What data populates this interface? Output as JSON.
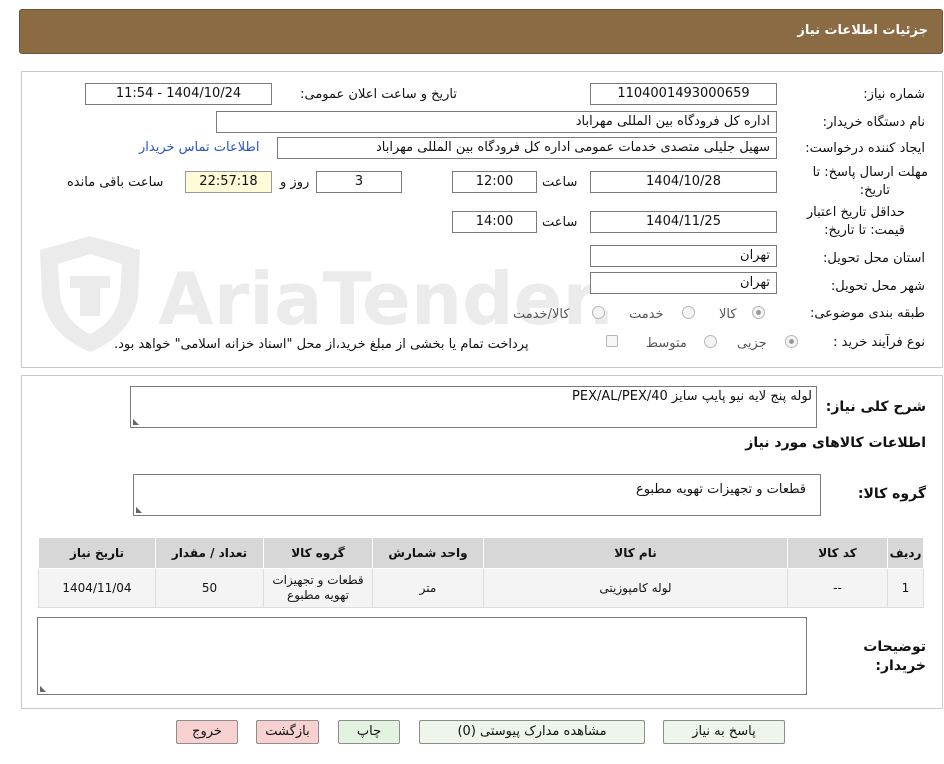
{
  "header": {
    "title": "جزئیات اطلاعات نیاز"
  },
  "watermark": {
    "text": "AriaTender.neT"
  },
  "form": {
    "need_number_label": "شماره نیاز:",
    "need_number_value": "1104001493000659",
    "announce_label": "تاریخ و ساعت اعلان عمومی:",
    "announce_value": "1404/10/24 - 11:54",
    "buyer_org_label": "نام دستگاه خریدار:",
    "buyer_org_value": "اداره کل فرودگاه بین المللی مهراباد",
    "requester_label": "ایجاد کننده درخواست:",
    "requester_value": "سهیل جلیلی متصدی خدمات عمومی اداره کل فرودگاه بین المللی مهراباد",
    "contact_link": "اطلاعات تماس خریدار",
    "deadline_label_1": "مهلت ارسال پاسخ: تا",
    "deadline_label_2": "تاریخ:",
    "deadline_date": "1404/10/28",
    "time_label": "ساعت",
    "deadline_time": "12:00",
    "days_value": "3",
    "days_label": "روز و",
    "remaining_time": "22:57:18",
    "remaining_label": "ساعت باقی مانده",
    "validity_label_1": "حداقل تاریخ اعتبار",
    "validity_label_2": "قیمت: تا تاریخ:",
    "validity_date": "1404/11/25",
    "validity_time": "14:00",
    "province_label": "استان محل تحویل:",
    "province_value": "تهران",
    "city_label": "شهر محل تحویل:",
    "city_value": "تهران",
    "category_label": "طبقه بندی موضوعی:",
    "category_options": [
      "کالا",
      "خدمت",
      "کالا/خدمت"
    ],
    "category_selected": "کالا",
    "process_label": "نوع فرآیند خرید :",
    "process_options": [
      "جزیی",
      "متوسط"
    ],
    "process_selected": "جزیی",
    "payment_note": "پرداخت تمام یا بخشی از مبلغ خرید،از محل \"اسناد خزانه اسلامی\" خواهد بود."
  },
  "description": {
    "label": "شرح کلی نیاز:",
    "value": "لوله پنج لایه نیو پایپ سایز PEX/AL/PEX/40"
  },
  "goods": {
    "section_title": "اطلاعات کالاهای مورد نیاز",
    "group_label": "گروه کالا:",
    "group_value": "قطعات و تجهیزات تهویه مطبوع"
  },
  "table": {
    "headers": [
      "ردیف",
      "کد کالا",
      "نام کالا",
      "واحد شمارش",
      "گروه کالا",
      "تعداد / مقدار",
      "تاریخ نیاز"
    ],
    "rows": [
      [
        "1",
        "--",
        "لوله کامپوزیتی",
        "متر",
        "قطعات و تجهیزات تهویه مطبوع",
        "50",
        "1404/11/04"
      ]
    ]
  },
  "buyer_notes": {
    "label_1": "توضیحات",
    "label_2": "خریدار:",
    "value": ""
  },
  "buttons": {
    "reply": "پاسخ به نیاز",
    "attachments": "مشاهده مدارک پیوستی (0)",
    "print": "چاپ",
    "back": "بازگشت",
    "exit": "خروج"
  },
  "colors": {
    "header_bg": "#8b6b43",
    "link": "#2a54c9",
    "time_bg": "#fffbd9",
    "btn_green": "#e2f3df",
    "btn_pink": "#f7d0d0"
  }
}
